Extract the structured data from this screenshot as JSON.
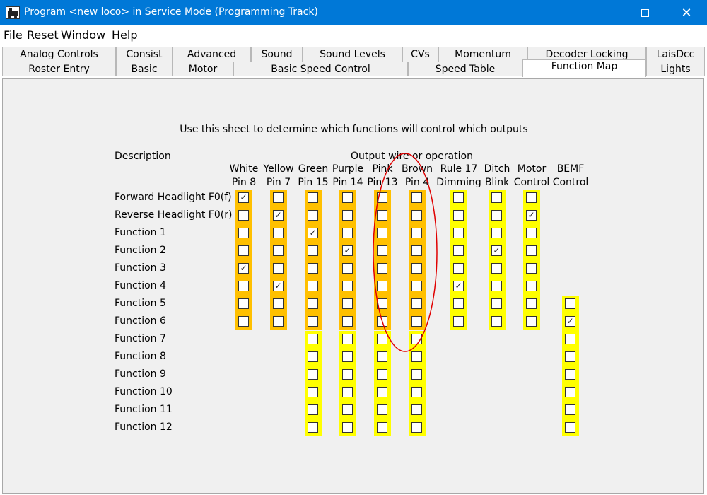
{
  "window": {
    "title": "Program <new loco> in Service Mode (Programming Track)",
    "min_glyph": "",
    "max_glyph": "",
    "close_glyph": "✕"
  },
  "menu": [
    "File",
    "Reset",
    "Window",
    "Help"
  ],
  "tabs_row1": [
    "Analog Controls",
    "Consist",
    "Advanced",
    "Sound",
    "Sound Levels",
    "CVs",
    "Momentum",
    "Decoder Locking",
    "LaisDcc"
  ],
  "tabs_row2": [
    "Roster Entry",
    "Basic",
    "Motor",
    "Basic Speed Control",
    "Speed Table",
    "Function Map",
    "Lights"
  ],
  "selected_tab": "Function Map",
  "function_map": {
    "instructions": "Use this sheet to determine which functions will control which outputs",
    "description_header": "Description",
    "output_header": "Output wire or operation",
    "columns": [
      {
        "line1": "White",
        "line2": "Pin 8",
        "color": "#ffc000"
      },
      {
        "line1": "Yellow",
        "line2": "Pin 7",
        "color": "#ffc000"
      },
      {
        "line1": "Green",
        "line2": "Pin 15",
        "color": "#ffc000"
      },
      {
        "line1": "Purple",
        "line2": "Pin 14",
        "color": "#ffc000"
      },
      {
        "line1": "Pink",
        "line2": "Pin 13",
        "color": "#ffc000"
      },
      {
        "line1": "Brown",
        "line2": "Pin 4",
        "color": "#ffc000"
      },
      {
        "line1": "Rule 17",
        "line2": "Dimming",
        "color": "#ffff00"
      },
      {
        "line1": "Ditch",
        "line2": "Blink",
        "color": "#ffff00"
      },
      {
        "line1": "Motor",
        "line2": "Control",
        "color": "#ffff00"
      },
      {
        "line1": "BEMF",
        "line2": "Control",
        "color": "#ffff00"
      }
    ],
    "rows": [
      "Forward Headlight F0(f)",
      "Reverse Headlight F0(r)",
      "Function 1",
      "Function 2",
      "Function 3",
      "Function 4",
      "Function 5",
      "Function 6",
      "Function 7",
      "Function 8",
      "Function 9",
      "Function 10",
      "Function 11",
      "Function 12"
    ],
    "checked": [
      [
        0,
        0
      ],
      [
        1,
        1
      ],
      [
        1,
        8
      ],
      [
        2,
        2
      ],
      [
        3,
        3
      ],
      [
        3,
        7
      ],
      [
        4,
        0
      ],
      [
        5,
        1
      ],
      [
        5,
        6
      ],
      [
        7,
        9
      ]
    ],
    "check_glyph": "✓",
    "highlight_color": "#e00000"
  }
}
